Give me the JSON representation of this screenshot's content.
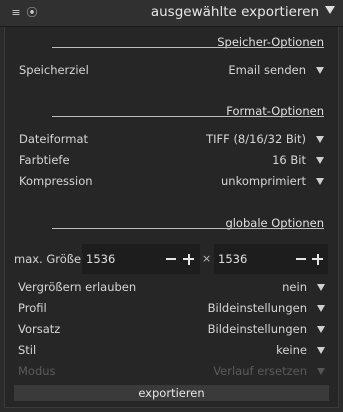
{
  "header": {
    "title": "ausgewählte exportieren"
  },
  "sections": {
    "storage": "Speicher-Optionen",
    "format": "Format-Optionen",
    "global": "globale Optionen"
  },
  "storage": {
    "target_label": "Speicherziel",
    "target_value": "Email senden"
  },
  "format": {
    "file_format_label": "Dateiformat",
    "file_format_value": "TIFF (8/16/32 Bit)",
    "bit_depth_label": "Farbtiefe",
    "bit_depth_value": "16 Bit",
    "compression_label": "Kompression",
    "compression_value": "unkomprimiert"
  },
  "global": {
    "max_size_label": "max. Größe",
    "width": "1536",
    "times": "×",
    "height": "1536",
    "upscale_label": "Vergrößern erlauben",
    "upscale_value": "nein",
    "profile_label": "Profil",
    "profile_value": "Bildeinstellungen",
    "intent_label": "Vorsatz",
    "intent_value": "Bildeinstellungen",
    "style_label": "Stil",
    "style_value": "keine",
    "mode_label": "Modus",
    "mode_value": "Verlauf ersetzen"
  },
  "export_button": "exportieren"
}
